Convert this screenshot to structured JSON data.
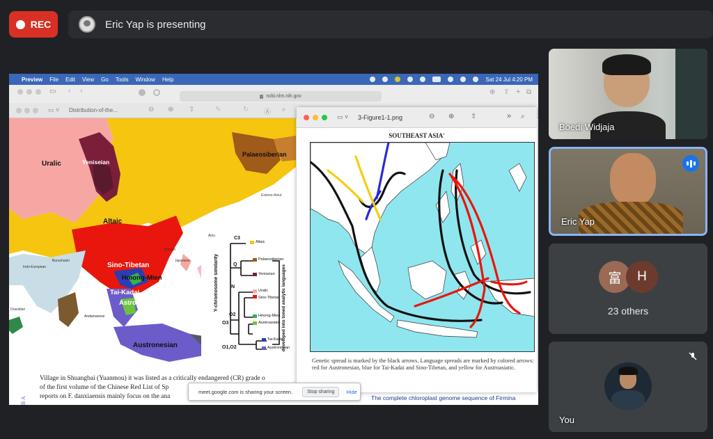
{
  "recording": {
    "label": "REC"
  },
  "presenting_bar": {
    "text": "Eric Yap is presenting"
  },
  "mac_menubar": {
    "app_menus": [
      "Preview",
      "File",
      "Edit",
      "View",
      "Go",
      "Tools",
      "Window",
      "Help"
    ],
    "clock": "Sat 24 Jul  4:20 PM"
  },
  "browser": {
    "url": "ncbi.nlm.nih.gov"
  },
  "preview_window_1": {
    "title": "Distribution-of-the...",
    "map_labels": {
      "uralic": "Uralic",
      "yeniseian": "Yeniseian",
      "palaeosiberian": "Palaeosiberian",
      "eskimo": "Eskimo-Aleut",
      "altaic": "Altaic",
      "korean": "Korean",
      "japanese": "Japanese",
      "indo_european": "Indo-European",
      "burushaski": "Burushaski",
      "dravidian": "Dravidian",
      "sino_tibetan": "Sino-Tibetan",
      "hmong_mien": "Hmong-Mien",
      "tai_kadai": "Tai-Kadai",
      "astroasiatic": "Astroasiatic",
      "andamanese": "Andamanese",
      "austronesian": "Austronesian",
      "papuan": "Papuan",
      "ainu": "Ainu"
    },
    "tree": {
      "axis_left": "Y-chromosome similarity",
      "axis_right": "developed into toned analytic languages",
      "nodes": [
        "C3",
        "Q",
        "N",
        "O2",
        "O3",
        "O1,O2"
      ],
      "leaves": [
        "Altaic",
        "Palaeosiberian",
        "Yeniseian",
        "Uralic",
        "Sino-Tibetan",
        "Hmong-Mien",
        "Austroasiatic",
        "Tai-Kadai",
        "Austronesian"
      ]
    }
  },
  "article_text": {
    "line1": "Village in Shuangbai (Yuanmou) it was listed as a critically endangered (CR) grade o",
    "line2": "of the first volume of the Chinese Red List of Sp",
    "line3": "reports on F. danxiaensis mainly focus on the ana",
    "side": "B A"
  },
  "preview_window_2": {
    "title": "3-Figure1-1.png",
    "map_title": "SOUTHEAST ASIA'",
    "caption": "Genetic spread is marked by the black arrows. Language spreads are marked by colored arrows: red for Austronesian, blue for Tai-Kadai and Sino-Tibetan, and yellow for Austroasiatic."
  },
  "screen_share_notice": {
    "text": "meet.google.com is sharing your screen.",
    "stop": "Stop sharing",
    "hide": "Hide"
  },
  "chloroplast_link": "The complete chloroplast genome sequence of Firmina",
  "participants": [
    {
      "name": "Boedi Widjaja"
    },
    {
      "name": "Eric Yap",
      "speaking": true
    },
    {
      "initials": [
        "富",
        "H"
      ],
      "others_label": "23 others"
    },
    {
      "name": "You",
      "muted": true
    }
  ],
  "colors": {
    "rec": "#d93025",
    "accent": "#8ab4f8",
    "speak": "#1a73e8"
  }
}
